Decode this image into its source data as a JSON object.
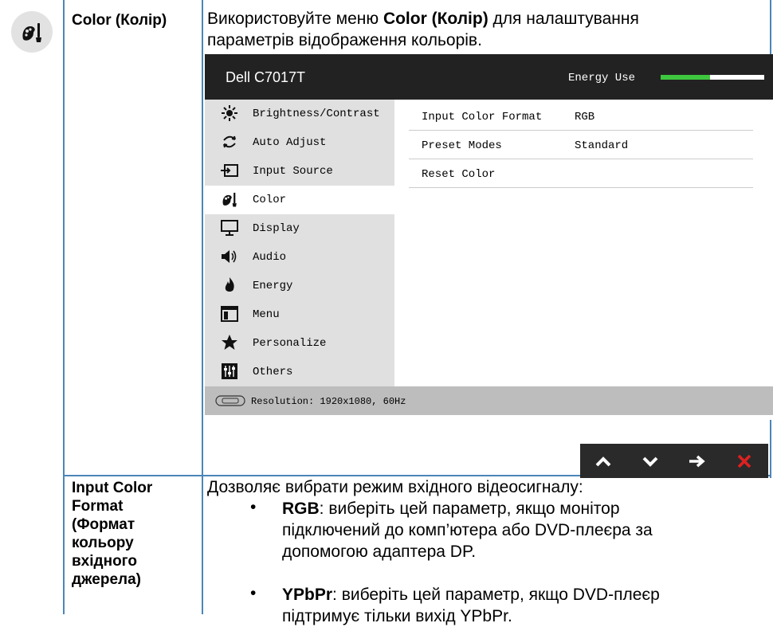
{
  "row1": {
    "term": "Color (Колір)",
    "desc_prefix": "Використовуйте меню ",
    "desc_bold": "Color (Колір)",
    "desc_suffix": " для налаштування",
    "desc_line2": "параметрів відображення кольорів."
  },
  "osd": {
    "model": "Dell C7017T",
    "energy_label": "Energy Use",
    "energy_level": 0.48,
    "menu_items": [
      {
        "icon": "sun-icon",
        "label": "Brightness/Contrast"
      },
      {
        "icon": "auto-adjust-icon",
        "label": "Auto Adjust"
      },
      {
        "icon": "input-source-icon",
        "label": "Input Source"
      },
      {
        "icon": "color-palette-icon",
        "label": "Color"
      },
      {
        "icon": "display-monitor-icon",
        "label": "Display"
      },
      {
        "icon": "speaker-icon",
        "label": "Audio"
      },
      {
        "icon": "flame-icon",
        "label": "Energy"
      },
      {
        "icon": "menu-window-icon",
        "label": "Menu"
      },
      {
        "icon": "star-icon",
        "label": "Personalize"
      },
      {
        "icon": "sliders-icon",
        "label": "Others"
      }
    ],
    "active_index": 3,
    "sub_rows": [
      {
        "key": "Input Color Format",
        "value": "RGB"
      },
      {
        "key": "Preset Modes",
        "value": "Standard"
      },
      {
        "key": "Reset Color",
        "value": ""
      }
    ],
    "footer": "Resolution: 1920x1080, 60Hz",
    "buttons": [
      "chevron-up-icon",
      "chevron-down-icon",
      "arrow-right-icon",
      "close-icon"
    ],
    "colors": {
      "header": "#222222",
      "menu": "#e0e0e0",
      "footer": "#bdbdbd",
      "energy": "#3fc63f",
      "close": "#e02020"
    }
  },
  "row2": {
    "term_lines": [
      "Input Color",
      "Format",
      "(Формат",
      "кольору",
      "вхідного",
      "джерела)"
    ],
    "intro": "Дозволяє вибрати режим вхідного відеосигналу:",
    "bullets": [
      {
        "bold": "RGB",
        "text": ": виберіть цей параметр, якщо монітор",
        "cont": [
          "підключений до комп’ютера або DVD-плеєра за",
          "допомогою адаптера DP."
        ]
      },
      {
        "bold": "YPbPr",
        "text": ": виберіть цей параметр, якщо DVD-плеєр",
        "cont": [
          "підтримує тільки вихід YPbPr."
        ]
      }
    ],
    "bullet_char": "•"
  }
}
